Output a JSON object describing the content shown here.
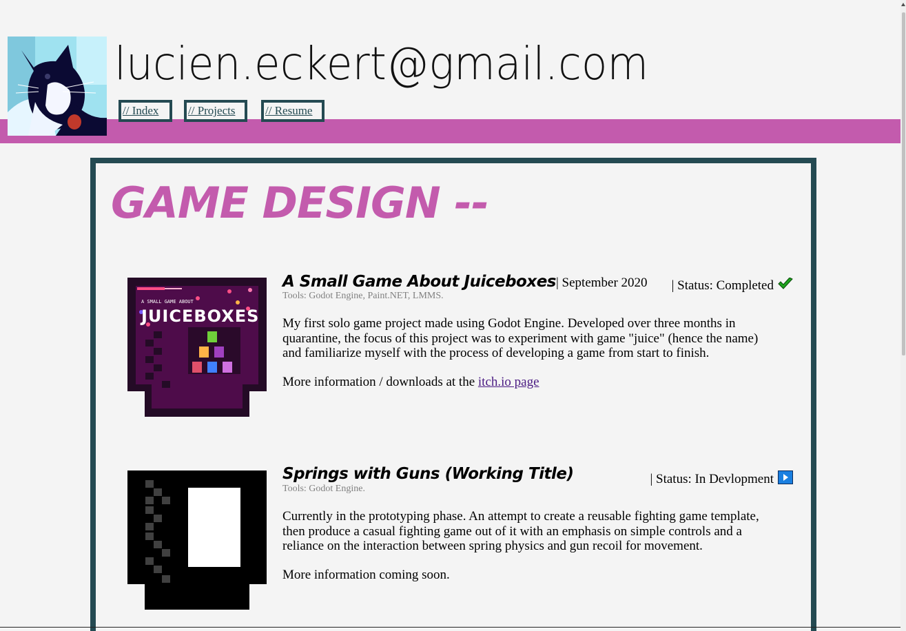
{
  "header": {
    "title": "lucien.eckert@gmail.com",
    "avatar_alt": "black and white cat avatar",
    "nav": [
      {
        "label": "// Index"
      },
      {
        "label": "// Projects"
      },
      {
        "label": "// Resume"
      }
    ]
  },
  "main": {
    "section_title": "GAME DESIGN --",
    "projects": [
      {
        "title": "A Small Game About Juiceboxes",
        "date": "| September 2020",
        "status": "| Status: Completed",
        "status_icon": "checkmark-icon",
        "tools": "Tools: Godot Engine, Paint.NET, LMMS.",
        "description": "My first solo game project made using Godot Engine. Developed over three months in quarantine, the focus of this project was to experiment with game \"juice\" (hence the name) and familiarize myself with the process of developing a game from start to finish.",
        "more_prefix": "More information / downloads at the ",
        "more_link": "itch.io page",
        "thumb_text_top": "A SMALL GAME ABOUT",
        "thumb_text_main": "JUICEBOXES"
      },
      {
        "title": "Springs with Guns (Working Title)",
        "date": "",
        "status": "| Status: In Devlopment",
        "status_icon": "play-icon",
        "tools": "Tools: Godot Engine.",
        "description": "Currently in the prototyping phase. An attempt to create a reusable fighting game template, then produce a casual fighting game out of it with an emphasis on simple controls and a reliance on the interaction between spring physics and gun recoil for movement.",
        "more_prefix": "More information coming soon.",
        "more_link": ""
      }
    ]
  },
  "colors": {
    "accent_pink": "#c35bad",
    "frame_teal": "#244a52",
    "background": "#f4f4f4",
    "link_purple": "#4a1a82"
  }
}
